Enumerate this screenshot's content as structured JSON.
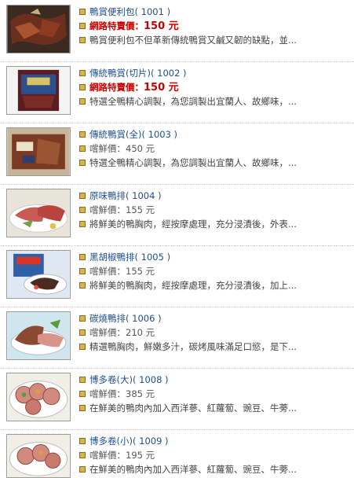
{
  "products": [
    {
      "name": "鴨賞便利包",
      "code": "( 1001 )",
      "price_label": "網路特賣價：",
      "price": "150 元",
      "price_type": "special",
      "desc": "鴨賞便利包不但革新傳統鴨賞又鹹又韌的缺點，並..."
    },
    {
      "name": "傳統鴨賞(切片)",
      "code": "( 1002 )",
      "price_label": "網路特賣價：",
      "price": "150 元",
      "price_type": "special",
      "desc": "特選全鴨精心調製，為您調製出宜蘭人、故鄉味，..."
    },
    {
      "name": "傳統鴨賞(全)",
      "code": "( 1003 )",
      "price_label": "嚐鮮價：",
      "price": "450 元",
      "price_type": "normal",
      "desc": "特選全鴨精心調製，為您調製出宜蘭人、故鄉味，..."
    },
    {
      "name": "原味鴨排",
      "code": "( 1004 )",
      "price_label": "嚐鮮價：",
      "price": "155 元",
      "price_type": "normal",
      "desc": "將鮮美的鴨胸肉，經按摩處理，充分浸漬後，外表..."
    },
    {
      "name": "黑胡椒鴨排",
      "code": "( 1005 )",
      "price_label": "嚐鮮價：",
      "price": "155 元",
      "price_type": "normal",
      "desc": "將鮮美的鴨胸肉，經按摩處理，充分浸漬後，加上..."
    },
    {
      "name": "碳燒鴨排",
      "code": "( 1006 )",
      "price_label": "嚐鮮價：",
      "price": "210 元",
      "price_type": "normal",
      "desc": "精選鴨胸肉，鮮嫩多汁，碳烤風味滿足口慾，是下..."
    },
    {
      "name": "博多卷(大)",
      "code": "( 1008 )",
      "price_label": "嚐鮮價：",
      "price": "385 元",
      "price_type": "normal",
      "desc": "在鮮美的鴨肉內加入西洋蔘、紅蘿蔔、豌豆、牛蒡..."
    },
    {
      "name": "博多卷(小)",
      "code": "( 1009 )",
      "price_label": "嚐鮮價：",
      "price": "195 元",
      "price_type": "normal",
      "desc": "在鮮美的鴨肉內加入西洋蔘、紅蘿蔔、豌豆、牛蒡..."
    }
  ],
  "colors": {
    "link": "#1f4e8c",
    "special_price": "#cc0000",
    "bullet": "#d8b24a"
  },
  "icons": {
    "bullet": "square-bullet-icon"
  }
}
